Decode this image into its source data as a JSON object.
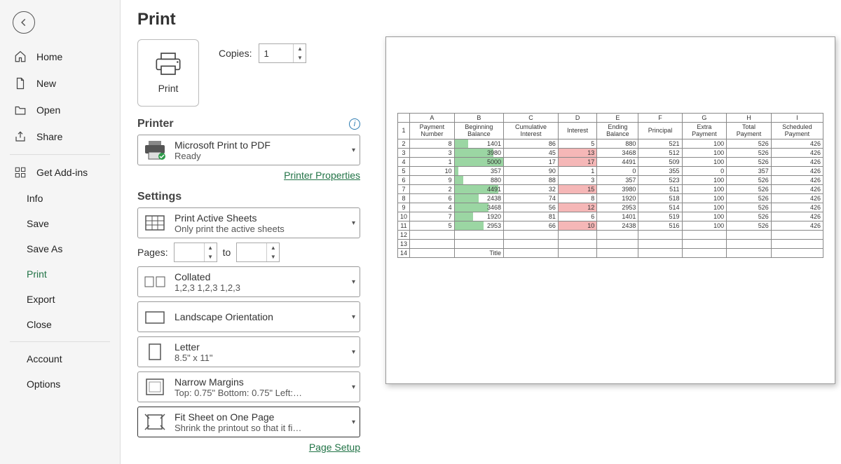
{
  "sidebar": {
    "items": [
      {
        "label": "Home",
        "icon": "home"
      },
      {
        "label": "New",
        "icon": "file"
      },
      {
        "label": "Open",
        "icon": "folder"
      },
      {
        "label": "Share",
        "icon": "share"
      }
    ],
    "items2": [
      {
        "label": "Get Add-ins",
        "icon": "addins"
      }
    ],
    "subitems": [
      {
        "label": "Info"
      },
      {
        "label": "Save"
      },
      {
        "label": "Save As"
      },
      {
        "label": "Print",
        "active": true
      },
      {
        "label": "Export"
      },
      {
        "label": "Close"
      }
    ],
    "footer": [
      {
        "label": "Account"
      },
      {
        "label": "Options"
      }
    ]
  },
  "page": {
    "title": "Print",
    "print_btn": "Print",
    "copies_label": "Copies:",
    "copies_value": "1"
  },
  "printer": {
    "section": "Printer",
    "name": "Microsoft Print to PDF",
    "status": "Ready",
    "properties_link": "Printer Properties"
  },
  "settings": {
    "section": "Settings",
    "print_what": {
      "title": "Print Active Sheets",
      "sub": "Only print the active sheets"
    },
    "pages_label": "Pages:",
    "to_label": "to",
    "pages_from": "",
    "pages_to": "",
    "collate": {
      "title": "Collated",
      "sub": "1,2,3    1,2,3    1,2,3"
    },
    "orientation": {
      "title": "Landscape Orientation",
      "sub": ""
    },
    "paper": {
      "title": "Letter",
      "sub": "8.5\" x 11\""
    },
    "margins": {
      "title": "Narrow Margins",
      "sub": "Top: 0.75\" Bottom: 0.75\" Left:…"
    },
    "scaling": {
      "title": "Fit Sheet on One Page",
      "sub": "Shrink the printout so that it fi…"
    },
    "page_setup_link": "Page Setup"
  },
  "preview": {
    "col_letters": [
      "A",
      "B",
      "C",
      "D",
      "E",
      "F",
      "G",
      "H",
      "I"
    ],
    "headers": [
      "Payment Number",
      "Beginning Balance",
      "Cumulative Interest",
      "Interest",
      "Ending Balance",
      "Principal",
      "Extra Payment",
      "Total Payment",
      "Scheduled Payment"
    ],
    "rows": [
      {
        "n": "2",
        "cells": [
          "8",
          "1401",
          "86",
          "5",
          "880",
          "521",
          "100",
          "526",
          "426"
        ],
        "bar": 28,
        "red": false
      },
      {
        "n": "3",
        "cells": [
          "3",
          "3980",
          "45",
          "13",
          "3468",
          "512",
          "100",
          "526",
          "426"
        ],
        "bar": 80,
        "red": true
      },
      {
        "n": "4",
        "cells": [
          "1",
          "5000",
          "17",
          "17",
          "4491",
          "509",
          "100",
          "526",
          "426"
        ],
        "bar": 100,
        "red": true
      },
      {
        "n": "5",
        "cells": [
          "10",
          "357",
          "90",
          "1",
          "0",
          "355",
          "0",
          "357",
          "426"
        ],
        "bar": 8,
        "red": false
      },
      {
        "n": "6",
        "cells": [
          "9",
          "880",
          "88",
          "3",
          "357",
          "523",
          "100",
          "526",
          "426"
        ],
        "bar": 18,
        "red": false
      },
      {
        "n": "7",
        "cells": [
          "2",
          "4491",
          "32",
          "15",
          "3980",
          "511",
          "100",
          "526",
          "426"
        ],
        "bar": 90,
        "red": true
      },
      {
        "n": "8",
        "cells": [
          "6",
          "2438",
          "74",
          "8",
          "1920",
          "518",
          "100",
          "526",
          "426"
        ],
        "bar": 49,
        "red": false
      },
      {
        "n": "9",
        "cells": [
          "4",
          "3468",
          "56",
          "12",
          "2953",
          "514",
          "100",
          "526",
          "426"
        ],
        "bar": 70,
        "red": true
      },
      {
        "n": "10",
        "cells": [
          "7",
          "1920",
          "81",
          "6",
          "1401",
          "519",
          "100",
          "526",
          "426"
        ],
        "bar": 38,
        "red": false
      },
      {
        "n": "11",
        "cells": [
          "5",
          "2953",
          "66",
          "10",
          "2438",
          "516",
          "100",
          "526",
          "426"
        ],
        "bar": 59,
        "red": true
      }
    ],
    "blank_rows": [
      "12",
      "13"
    ],
    "title_row": {
      "n": "14",
      "label": "Title"
    }
  },
  "chart_data": {
    "type": "table",
    "title": "Loan amortization schedule (print preview)",
    "columns": [
      "Payment Number",
      "Beginning Balance",
      "Cumulative Interest",
      "Interest",
      "Ending Balance",
      "Principal",
      "Extra Payment",
      "Total Payment",
      "Scheduled Payment"
    ],
    "rows": [
      [
        8,
        1401,
        86,
        5,
        880,
        521,
        100,
        526,
        426
      ],
      [
        3,
        3980,
        45,
        13,
        3468,
        512,
        100,
        526,
        426
      ],
      [
        1,
        5000,
        17,
        17,
        4491,
        509,
        100,
        526,
        426
      ],
      [
        10,
        357,
        90,
        1,
        0,
        355,
        0,
        357,
        426
      ],
      [
        9,
        880,
        88,
        3,
        357,
        523,
        100,
        526,
        426
      ],
      [
        2,
        4491,
        32,
        15,
        3980,
        511,
        100,
        526,
        426
      ],
      [
        6,
        2438,
        74,
        8,
        1920,
        518,
        100,
        526,
        426
      ],
      [
        4,
        3468,
        56,
        12,
        2953,
        514,
        100,
        526,
        426
      ],
      [
        7,
        1920,
        81,
        6,
        1401,
        519,
        100,
        526,
        426
      ],
      [
        5,
        2953,
        66,
        10,
        2438,
        516,
        100,
        526,
        426
      ]
    ],
    "highlight": {
      "column": "Interest",
      "threshold_color": "#f5b7b7",
      "note": "Interest cells highlighted red when value >= 10"
    },
    "databar": {
      "column": "Beginning Balance",
      "min": 0,
      "max": 5000,
      "color": "#9bd6a3"
    }
  }
}
